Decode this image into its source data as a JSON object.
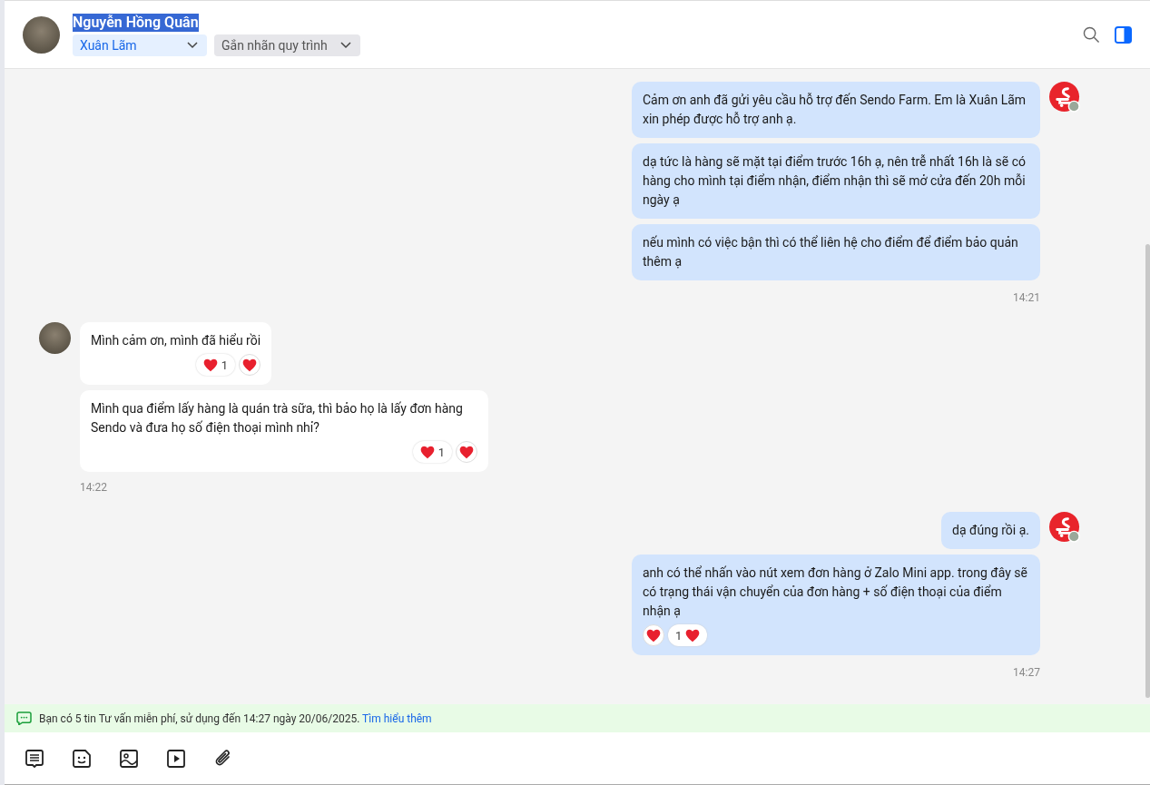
{
  "header": {
    "name": "Nguyễn Hồng Quân",
    "name_highlighted": true,
    "assignee": "Xuân Lãm",
    "label_dropdown": "Gắn nhãn quy trình"
  },
  "groups": [
    {
      "kind": "agent",
      "time": "14:21",
      "messages": [
        {
          "text": "Cảm ơn anh đã gửi yêu cầu hỗ trợ đến Sendo Farm. Em là Xuân Lãm xin phép được hỗ trợ anh ạ."
        },
        {
          "text": "dạ tức là hàng sẽ mặt tại điểm trước 16h ạ, nên trễ nhất 16h là sẽ có hàng cho mình tại điểm nhận, điểm nhận thì sẽ mở cửa đến 20h mỗi ngày ạ"
        },
        {
          "text": "nếu mình có việc bận thì có thể liên hệ cho điểm để điểm bảo quản thêm ạ"
        }
      ]
    },
    {
      "kind": "customer",
      "time": "14:22",
      "messages": [
        {
          "text": "Mình cảm ơn, mình đã hiểu rồi",
          "reaction_count": "1"
        },
        {
          "text": "Mình qua điểm lấy hàng là quán trà sữa, thì bảo họ là lấy đơn hàng Sendo và đưa họ số điện thoại mình nhỉ?",
          "reaction_count": "1"
        }
      ]
    },
    {
      "kind": "agent",
      "time": "14:27",
      "messages": [
        {
          "text": "dạ đúng rồi ạ."
        },
        {
          "text": "anh có thể nhấn vào nút xem đơn hàng ở Zalo Mini app. trong đây sẽ có trạng thái vận chuyển của đơn hàng + số điện thoại của điểm nhận ạ",
          "reaction_count": "1"
        }
      ]
    }
  ],
  "notice": {
    "text": "Bạn có 5 tin Tư vấn miễn phí, sử dụng đến 14:27 ngày 20/06/2025.",
    "link": "Tìm hiểu thêm"
  }
}
